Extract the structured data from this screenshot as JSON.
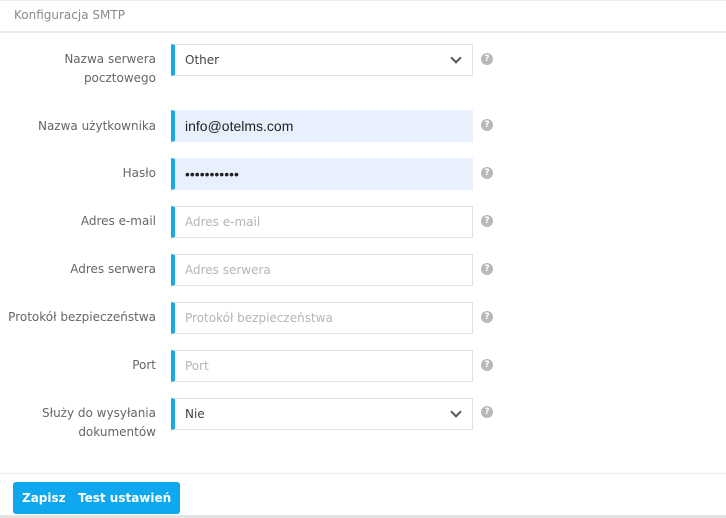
{
  "panel": {
    "title": "Konfiguracja SMTP"
  },
  "form": {
    "mail_server": {
      "label": "Nazwa serwera pocztowego",
      "label_line1": "Nazwa serwera",
      "label_line2": "pocztowego",
      "value": "Other"
    },
    "username": {
      "label": "Nazwa użytkownika",
      "value": "info@otelms.com"
    },
    "password": {
      "label": "Hasło",
      "value_masked": "•••••••••••"
    },
    "email": {
      "label": "Adres e-mail",
      "placeholder": "Adres e-mail"
    },
    "server_address": {
      "label": "Adres serwera",
      "placeholder": "Adres serwera"
    },
    "security_protocol": {
      "label": "Protokół bezpieczeństwa",
      "placeholder": "Protokół bezpieczeństwa"
    },
    "port": {
      "label": "Port",
      "placeholder": "Port"
    },
    "used_for_documents": {
      "label": "Służy do wysyłania dokumentów",
      "label_line1": "Służy do wysyłania",
      "label_line2": "dokumentów",
      "value": "Nie"
    },
    "help_icon": "?"
  },
  "footer": {
    "save_label": "Zapisz",
    "test_label": "Test ustawień"
  },
  "colors": {
    "accent": "#0fa8ee",
    "field_indicator": "#19a8e8",
    "autofill_bg": "#e8f0fe"
  }
}
